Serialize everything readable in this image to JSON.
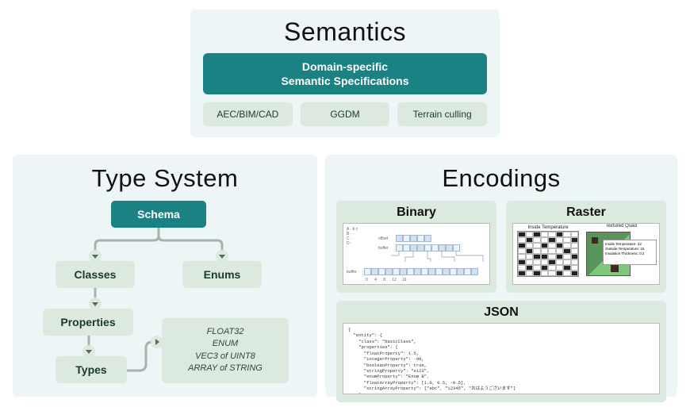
{
  "semantics": {
    "title": "Semantics",
    "banner_line1": "Domain-specific",
    "banner_line2": "Semantic Specifications",
    "chips": [
      "AEC/BIM/CAD",
      "GGDM",
      "Terrain culling"
    ]
  },
  "typesystem": {
    "title": "Type System",
    "schema": "Schema",
    "classes": "Classes",
    "enums": "Enums",
    "properties": "Properties",
    "types": "Types",
    "type_examples": [
      "FLOAT32",
      "ENUM",
      "VEC3 of UINT8",
      "ARRAY of STRING"
    ]
  },
  "encodings": {
    "title": "Encodings",
    "binary": {
      "title": "Binary",
      "labels": {
        "offset": "offset",
        "buffer": "buffer"
      }
    },
    "raster": {
      "title": "Raster",
      "left_label": "Inside Temperature",
      "right_label": "Textured Quad",
      "info": {
        "l1": "Inside Temperature:  22",
        "l2": "Outside Temperature: 15",
        "l3": "Insulation Thickness: 0.2"
      }
    },
    "json": {
      "title": "JSON",
      "code": "{\n  \"entity\": {\n    \"class\": \"basicClass\",\n    \"properties\": {\n      \"floatProperty\": 1.5,\n      \"integerProperty\": -90,\n      \"booleanProperty\": true,\n      \"stringProperty\": \"x123\",\n      \"enumProperty\": \"Enum B\",\n      \"floatArrayProperty\": [1.0, 0.5, -0.5],\n      \"stringArrayProperty\": [\"abc\", \"12345\", \"おはようございます\"]\n    }\n  }\n}"
    }
  }
}
